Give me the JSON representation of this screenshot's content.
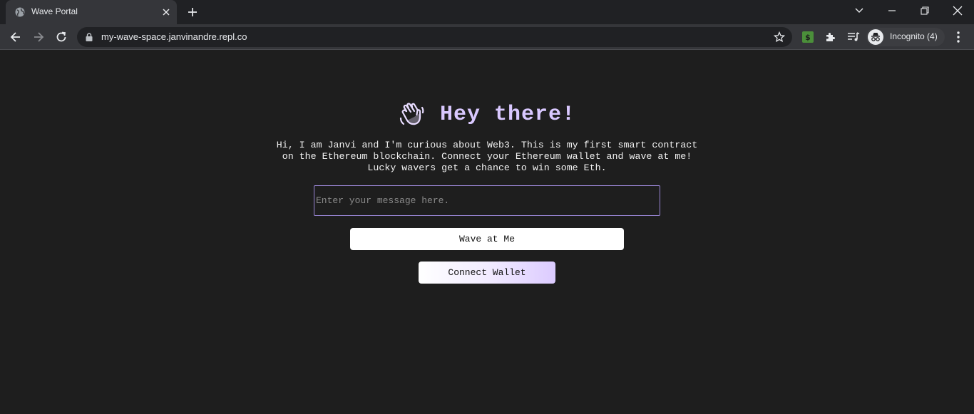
{
  "browser": {
    "tab_title": "Wave Portal",
    "url": "my-wave-space.janvinandre.repl.co",
    "incognito_label": "Incognito (4)"
  },
  "page": {
    "heading": "Hey there!",
    "bio": "Hi, I am Janvi and I'm curious about Web3. This is my first smart contract on the Ethereum blockchain. Connect your Ethereum wallet and wave at me! Lucky wavers get a chance to win some Eth.",
    "message_placeholder": "Enter your message here.",
    "message_value": "",
    "wave_button": "Wave at Me",
    "connect_button": "Connect Wallet"
  },
  "colors": {
    "background": "#1e1e1e",
    "heading": "#d9c8ff",
    "input_border": "#9a86d6",
    "chrome_dark": "#202124",
    "chrome_toolbar": "#35363a"
  },
  "icons": [
    "globe-icon",
    "close-icon",
    "new-tab-icon",
    "chevron-down-icon",
    "minimize-icon",
    "restore-icon",
    "window-close-icon",
    "back-icon",
    "forward-icon",
    "reload-icon",
    "lock-icon",
    "star-icon",
    "dollar-extension-icon",
    "puzzle-icon",
    "media-queue-icon",
    "incognito-icon",
    "more-menu-icon",
    "waving-hand-icon"
  ]
}
